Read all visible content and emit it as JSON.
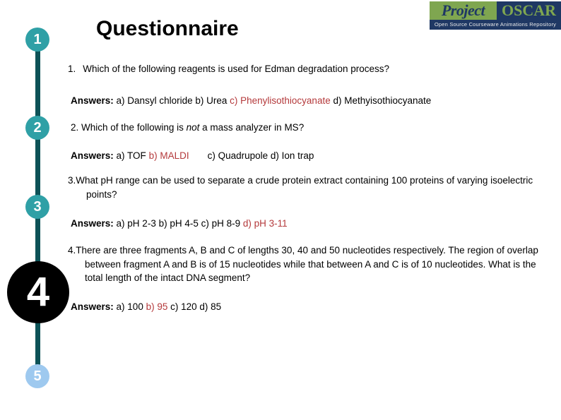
{
  "slide": {
    "title": "Questionnaire"
  },
  "logo": {
    "word_project": "Project",
    "word_oscar": "OSCAR",
    "tagline": "Open Source Courseware Animations Repository"
  },
  "timeline": {
    "nodes": [
      {
        "label": "1",
        "state": "inactive",
        "color": "#2fa0a6"
      },
      {
        "label": "2",
        "state": "inactive",
        "color": "#2fa0a6"
      },
      {
        "label": "3",
        "state": "inactive",
        "color": "#2fa0a6"
      },
      {
        "label": "4",
        "state": "active",
        "color": "#000000"
      },
      {
        "label": "5",
        "state": "upcoming",
        "color": "#9ec9ef"
      }
    ],
    "line_color": "#0d5257"
  },
  "answers_label": "Answers:",
  "correct_color": "#b4393b",
  "questions": [
    {
      "number": "1.",
      "text": "Which of the following reagents is used for Edman degradation process?",
      "options_before": "a) Dansyl chloride b) Urea",
      "correct_option": "c) Phenylisothiocyanate",
      "options_after": "d) Methyisothiocyanate"
    },
    {
      "number": "2.",
      "text_part1": "Which of the following is ",
      "text_italic": "not",
      "text_part2": " a mass analyzer in MS?",
      "options_before": "a) TOF",
      "correct_option": "b) MALDI",
      "options_after": "c) Quadrupole   d) Ion trap"
    },
    {
      "number": "3.",
      "text_line1": "What pH range can be used to separate a crude protein extract containing 100 proteins of",
      "text_line2": "varying isoelectric points?",
      "options_before": "a) pH 2-3 b) pH 4-5 c)  pH 8-9",
      "correct_option": "d) pH 3-11",
      "options_after": ""
    },
    {
      "number": "4.",
      "text_line1": "There are three fragments A, B and C of lengths 30, 40 and 50 nucleotides respectively. The",
      "text_line2": "region of overlap between fragment A and B is of 15 nucleotides while that between A and",
      "text_line3": "C is of 10 nucleotides. What is the total length of the intact DNA segment?",
      "options_before": "a) 100",
      "correct_option": "b) 95",
      "options_after": "c) 120  d) 85"
    }
  ]
}
